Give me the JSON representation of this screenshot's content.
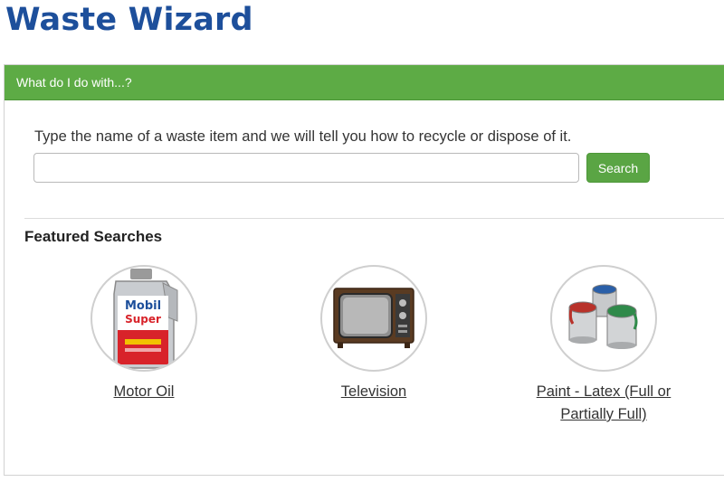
{
  "app": {
    "title": "Waste Wizard"
  },
  "panel": {
    "header": "What do I do with...?",
    "intro": "Type the name of a waste item and we will tell you how to recycle or dispose of it.",
    "search": {
      "value": "",
      "placeholder": "",
      "button_label": "Search"
    }
  },
  "featured": {
    "heading": "Featured Searches",
    "items": [
      {
        "label": "Motor Oil",
        "image": "motor-oil-bottle",
        "image_text": [
          "Mobil",
          "Super"
        ]
      },
      {
        "label": "Television",
        "image": "crt-television"
      },
      {
        "label": "Paint - Latex (Full or Partially Full)",
        "image": "paint-cans"
      }
    ]
  },
  "colors": {
    "title": "#1d4f9b",
    "header_bg": "#5dab45",
    "button_bg": "#5aa544"
  }
}
